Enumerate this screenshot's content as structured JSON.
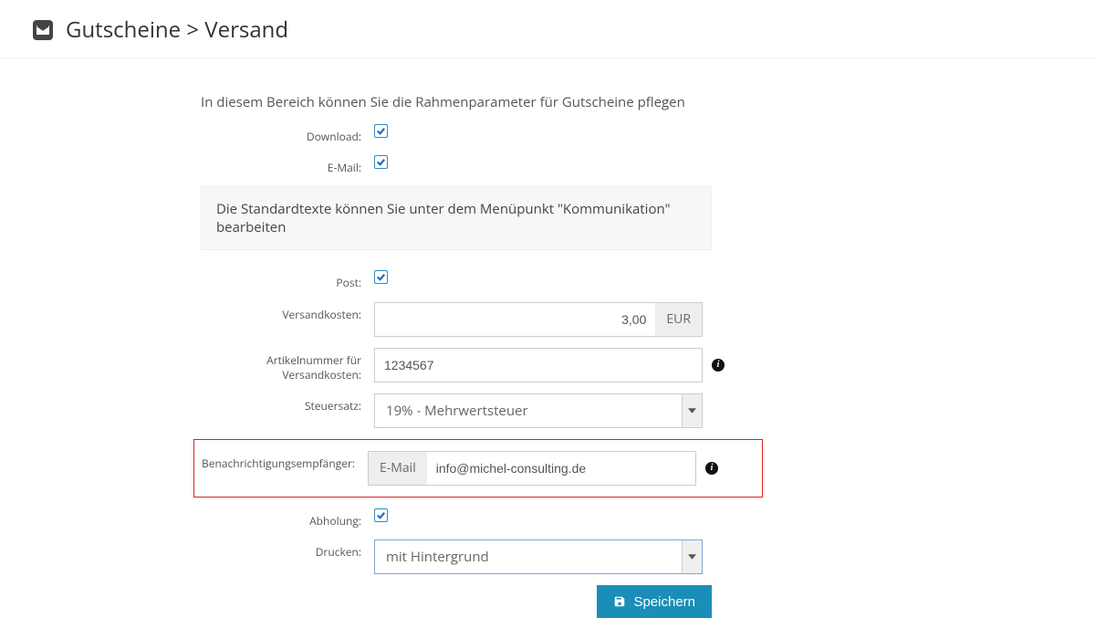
{
  "header": {
    "title": "Gutscheine > Versand"
  },
  "intro": "In diesem Bereich können Sie die Rahmenparameter für Gutscheine pflegen",
  "note": "Die Standardtexte können Sie unter dem Menüpunkt \"Kommunikation\" bearbeiten",
  "fields": {
    "download_label": "Download:",
    "email_label": "E-Mail:",
    "post_label": "Post:",
    "versandkosten_label": "Versandkosten:",
    "versandkosten_value": "3,00",
    "versandkosten_unit": "EUR",
    "artikelnummer_label": "Artikelnummer für Versandkosten:",
    "artikelnummer_value": "1234567",
    "steuersatz_label": "Steuersatz:",
    "steuersatz_value": "19% - Mehrwertsteuer",
    "benachrichtigung_label": "Benachrichtigungsempfänger:",
    "benachrichtigung_prefix": "E-Mail",
    "benachrichtigung_value": "info@michel-consulting.de",
    "abholung_label": "Abholung:",
    "drucken_label": "Drucken:",
    "drucken_value": "mit Hintergrund"
  },
  "buttons": {
    "save": "Speichern"
  }
}
